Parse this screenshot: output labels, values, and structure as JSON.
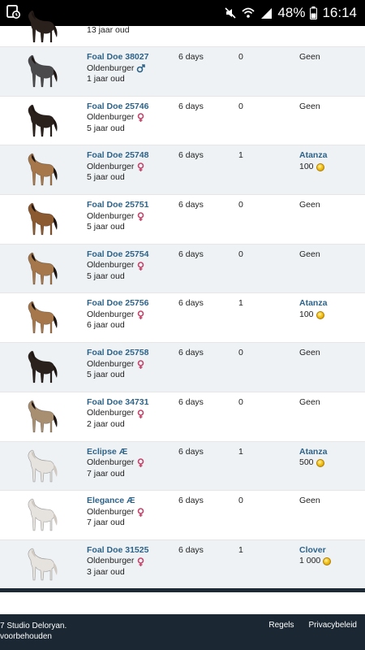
{
  "statusbar": {
    "battery": "48%",
    "time": "16:14"
  },
  "rows": [
    {
      "name": "",
      "breed": "",
      "sex": "",
      "age": "13 jaar oud",
      "days": "",
      "bids": "",
      "bidder": "",
      "price": "",
      "coat": "dark"
    },
    {
      "name": "Foal Doe 38027",
      "breed": "Oldenburger",
      "sex": "male",
      "age": "1 jaar oud",
      "days": "6 days",
      "bids": "0",
      "bidder": "Geen",
      "price": "",
      "coat": "grey"
    },
    {
      "name": "Foal Doe 25746",
      "breed": "Oldenburger",
      "sex": "female",
      "age": "5 jaar oud",
      "days": "6 days",
      "bids": "0",
      "bidder": "Geen",
      "price": "",
      "coat": "dark"
    },
    {
      "name": "Foal Doe 25748",
      "breed": "Oldenburger",
      "sex": "female",
      "age": "5 jaar oud",
      "days": "6 days",
      "bids": "1",
      "bidder": "Atanza",
      "price": "100",
      "coat": "buck"
    },
    {
      "name": "Foal Doe 25751",
      "breed": "Oldenburger",
      "sex": "female",
      "age": "5 jaar oud",
      "days": "6 days",
      "bids": "0",
      "bidder": "Geen",
      "price": "",
      "coat": "bay"
    },
    {
      "name": "Foal Doe 25754",
      "breed": "Oldenburger",
      "sex": "female",
      "age": "5 jaar oud",
      "days": "6 days",
      "bids": "0",
      "bidder": "Geen",
      "price": "",
      "coat": "buck"
    },
    {
      "name": "Foal Doe 25756",
      "breed": "Oldenburger",
      "sex": "female",
      "age": "6 jaar oud",
      "days": "6 days",
      "bids": "1",
      "bidder": "Atanza",
      "price": "100",
      "coat": "buck"
    },
    {
      "name": "Foal Doe 25758",
      "breed": "Oldenburger",
      "sex": "female",
      "age": "5 jaar oud",
      "days": "6 days",
      "bids": "0",
      "bidder": "Geen",
      "price": "",
      "coat": "dark"
    },
    {
      "name": "Foal Doe 34731",
      "breed": "Oldenburger",
      "sex": "female",
      "age": "2 jaar oud",
      "days": "6 days",
      "bids": "0",
      "bidder": "Geen",
      "price": "",
      "coat": "dun"
    },
    {
      "name": "Eclipse Æ",
      "breed": "Oldenburger",
      "sex": "female",
      "age": "7 jaar oud",
      "days": "6 days",
      "bids": "1",
      "bidder": "Atanza",
      "price": "500",
      "coat": "white"
    },
    {
      "name": "Elegance Æ",
      "breed": "Oldenburger",
      "sex": "female",
      "age": "7 jaar oud",
      "days": "6 days",
      "bids": "0",
      "bidder": "Geen",
      "price": "",
      "coat": "white"
    },
    {
      "name": "Foal Doe 31525",
      "breed": "Oldenburger",
      "sex": "female",
      "age": "3 jaar oud",
      "days": "6 days",
      "bids": "1",
      "bidder": "Clover",
      "price": "1 000",
      "coat": "white"
    }
  ],
  "coat_colors": {
    "dark": "#2b211c",
    "grey": "#4a4a4d",
    "buck": "#a5774a",
    "bay": "#8b5a30",
    "dun": "#a88f72",
    "white": "#e6e3df"
  },
  "sex_colors": {
    "male": "#2d6389",
    "female": "#c2456b"
  },
  "footer": {
    "copyright_line1": "7 Studio Deloryan.",
    "copyright_line2": "voorbehouden",
    "link_rules": "Regels",
    "link_privacy": "Privacybeleid"
  }
}
